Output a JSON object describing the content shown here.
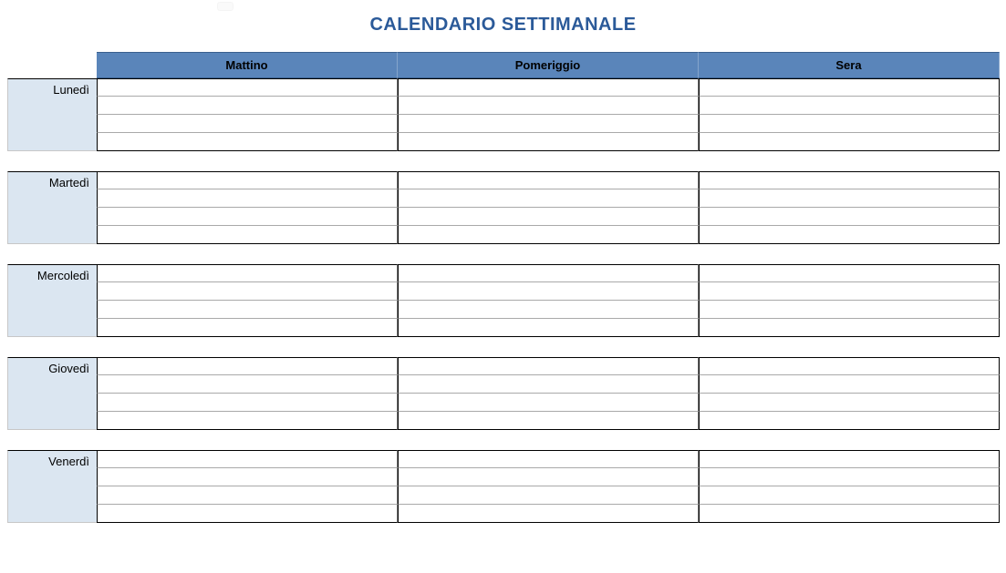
{
  "title": "CALENDARIO SETTIMANALE",
  "columns": [
    "Mattino",
    "Pomeriggio",
    "Sera"
  ],
  "days": [
    "Lunedì",
    "Martedì",
    "Mercoledì",
    "Giovedì",
    "Venerdì"
  ],
  "rows_per_day": 4,
  "cells": {
    "Lunedì": {
      "Mattino": [
        "",
        "",
        "",
        ""
      ],
      "Pomeriggio": [
        "",
        "",
        "",
        ""
      ],
      "Sera": [
        "",
        "",
        "",
        ""
      ]
    },
    "Martedì": {
      "Mattino": [
        "",
        "",
        "",
        ""
      ],
      "Pomeriggio": [
        "",
        "",
        "",
        ""
      ],
      "Sera": [
        "",
        "",
        "",
        ""
      ]
    },
    "Mercoledì": {
      "Mattino": [
        "",
        "",
        "",
        ""
      ],
      "Pomeriggio": [
        "",
        "",
        "",
        ""
      ],
      "Sera": [
        "",
        "",
        "",
        ""
      ]
    },
    "Giovedì": {
      "Mattino": [
        "",
        "",
        "",
        ""
      ],
      "Pomeriggio": [
        "",
        "",
        "",
        ""
      ],
      "Sera": [
        "",
        "",
        "",
        ""
      ]
    },
    "Venerdì": {
      "Mattino": [
        "",
        "",
        "",
        ""
      ],
      "Pomeriggio": [
        "",
        "",
        "",
        ""
      ],
      "Sera": [
        "",
        "",
        "",
        ""
      ]
    }
  }
}
